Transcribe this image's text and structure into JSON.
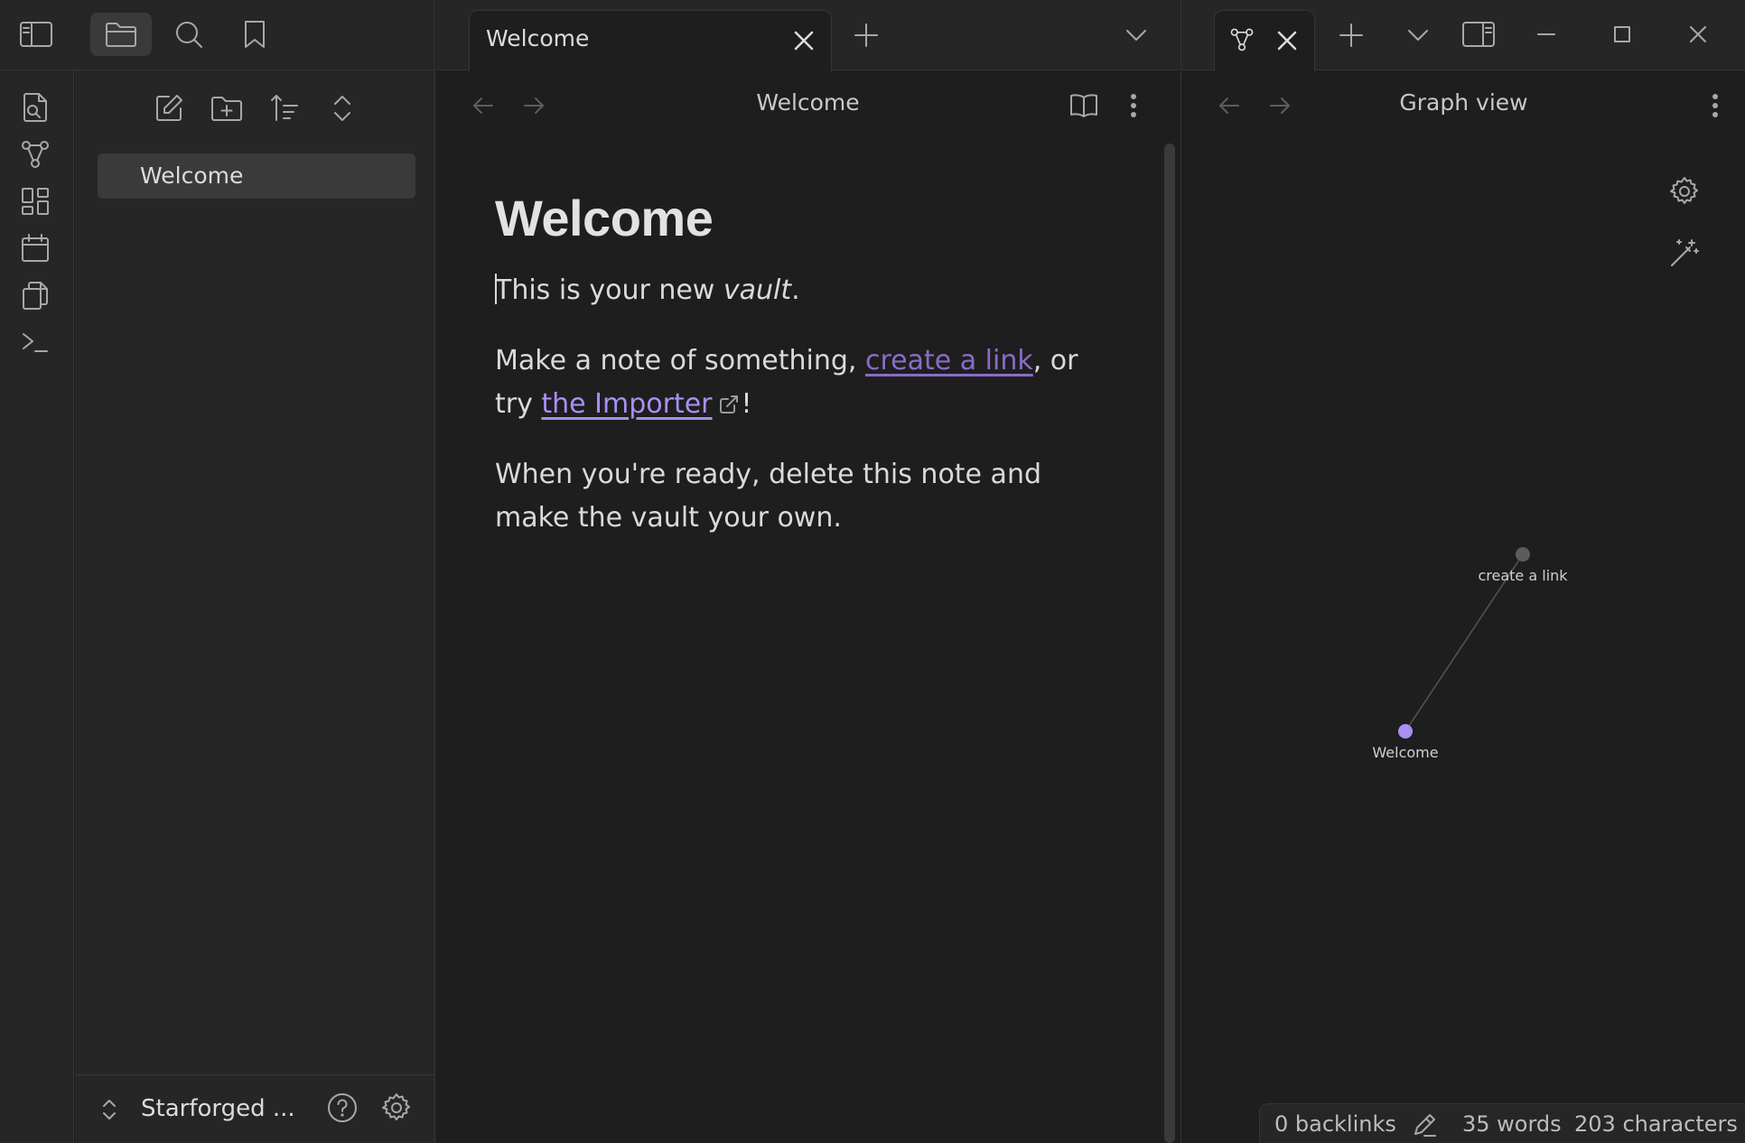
{
  "left_toolbar": {
    "sidebar_toggle_icon": "sidebar-left-icon",
    "files_icon": "folder-icon",
    "search_icon": "search-icon",
    "bookmarks_icon": "bookmark-icon"
  },
  "ribbon": {
    "items": [
      "quick-switcher-icon",
      "graph-icon",
      "canvas-icon",
      "calendar-icon",
      "templates-icon",
      "terminal-icon"
    ]
  },
  "file_explorer": {
    "actions": [
      "new-note-icon",
      "new-folder-icon",
      "sort-icon",
      "expand-collapse-icon"
    ],
    "files": [
      {
        "name": "Welcome",
        "selected": true
      }
    ]
  },
  "vault": {
    "name": "Starforged ...",
    "help_icon": "help-icon",
    "settings_icon": "gear-icon"
  },
  "center_tabs": {
    "tabs": [
      {
        "label": "Welcome",
        "active": true
      }
    ],
    "new_tab_icon": "plus-icon",
    "tab_list_icon": "chevron-down-icon"
  },
  "editor": {
    "header_title": "Welcome",
    "reading_view_icon": "book-open-icon",
    "more_icon": "more-vertical-icon",
    "note": {
      "title": "Welcome",
      "p1_before": "This is your new ",
      "p1_em": "vault",
      "p1_after": ".",
      "p2_before": "Make a note of something, ",
      "p2_link_internal": "create a link",
      "p2_middle": ", or try ",
      "p2_link_external": "the Importer",
      "p2_after": "!",
      "p3": "When you're ready, delete this note and make the vault your own."
    }
  },
  "right_tabs": {
    "tabs": [
      {
        "icon": "graph-icon",
        "active": true
      }
    ],
    "new_tab_icon": "plus-icon",
    "tab_list_icon": "chevron-down-icon",
    "toggle_right_sidebar_icon": "sidebar-right-icon"
  },
  "window_controls": [
    "minimize-icon",
    "maximize-icon",
    "close-icon"
  ],
  "graph_view": {
    "header_title": "Graph view",
    "settings_icon": "gear-icon",
    "animate_icon": "magic-wand-icon",
    "nodes": [
      {
        "id": "create_link",
        "label": "create a link",
        "color": "#5c5c5c",
        "resolved": false
      },
      {
        "id": "welcome",
        "label": "Welcome",
        "color": "#a98ff5",
        "resolved": true
      }
    ],
    "edges": [
      [
        "welcome",
        "create_link"
      ]
    ]
  },
  "status_bar": {
    "backlinks": "0 backlinks",
    "edit_icon": "pencil-icon",
    "words": "35 words",
    "characters": "203 characters"
  },
  "colors": {
    "accent": "#a98ff5",
    "internal_link": "#8a6cc9",
    "background": "#1e1e1e",
    "panel": "#262626"
  }
}
